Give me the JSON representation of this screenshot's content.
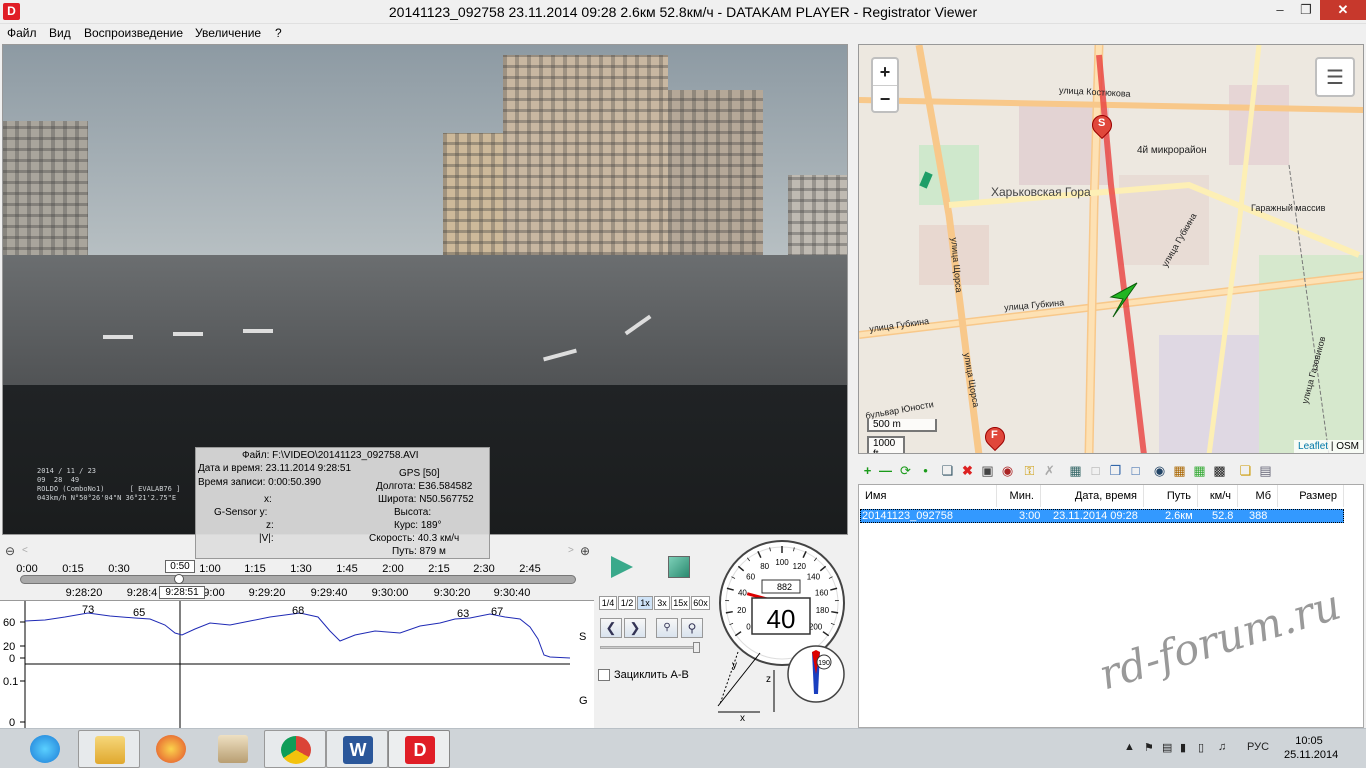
{
  "window": {
    "logo_letter": "D",
    "title": "20141123_092758     23.11.2014 09:28     2.6км     52.8км/ч   -  DATAKAM PLAYER - Registrator Viewer",
    "min": "–",
    "max": "❐",
    "close": "✕"
  },
  "menu": [
    "Файл",
    "Вид",
    "Воспроизведение",
    "Увеличение",
    "?"
  ],
  "video": {
    "osd": "2014 / 11 / 23\n09  28  49\nROLDO (ComboNo1)      [ EVALAB76 ]\n043km/h N°50°26'04\"N 36°21'2.75\"E"
  },
  "info": {
    "file": "Файл: F:\\VIDEO\\20141123_092758.AVI",
    "datetime": "Дата и время: 23.11.2014 9:28:51",
    "rec_time": "Время записи: 0:00:50.390",
    "gps": "GPS [50]",
    "lon": "Долгота: E36.584582",
    "lat": "Широта: N50.567752",
    "alt": "Высота:",
    "course": "Курс: 189°",
    "speed": "Скорость: 40.3 км/ч",
    "path": "Путь: 879 м",
    "x": "x:",
    "gsensor_y": "G-Sensor y:",
    "z": "z:",
    "v": "|V|:"
  },
  "timeline": {
    "ticks": [
      "0:00",
      "0:15",
      "0:30",
      "1:00",
      "1:15",
      "1:30",
      "1:45",
      "2:00",
      "2:15",
      "2:30",
      "2:45"
    ],
    "times": [
      "9:28:20",
      "9:28:4",
      "9:28:51",
      "9:00",
      "9:29:20",
      "9:29:40",
      "9:30:00",
      "9:30:20",
      "9:30:40"
    ],
    "position": "0:50",
    "position_time": "9:28:51",
    "progress": 0.27
  },
  "graph": {
    "speed_labels": [
      "73",
      "65",
      "68",
      "63",
      "67"
    ],
    "y_ticks_s": [
      "60",
      "20",
      "0"
    ],
    "y_ticks_g": [
      "0.1",
      "0"
    ],
    "axis_s": "S",
    "axis_g": "G"
  },
  "controls": {
    "speeds": [
      "1/4",
      "1/2",
      "1x",
      "3x",
      "15x",
      "60x"
    ],
    "loop_label": "Зациклить А-В"
  },
  "speedometer": {
    "value": "40",
    "odometer": "882",
    "scale": [
      "0",
      "20",
      "40",
      "60",
      "80",
      "100",
      "120",
      "140",
      "160",
      "180",
      "200"
    ],
    "speed_fraction": 0.2
  },
  "map": {
    "zoom_in": "+",
    "zoom_out": "−",
    "scale_m": "500 m",
    "scale_ft": "1000 ft",
    "attrib_leaflet": "Leaflet",
    "attrib_osm": "OSM",
    "streets": [
      "улица Костюкова",
      "4й микрорайон",
      "Харьковская Гора",
      "Гаражный массив",
      "улица Губкина",
      "улица Губкина",
      "улица Губкина",
      "улица Щорса",
      "улица Щорса",
      "бульвар Юности",
      "улица Газовиков"
    ],
    "start_marker": "S",
    "finish_marker": "F"
  },
  "table": {
    "headers": [
      "Имя",
      "Мин.",
      "Дата, время",
      "Путь",
      "км/ч",
      "Мб",
      "Размер"
    ],
    "rows": [
      [
        "20141123_092758",
        "3:00",
        "23.11.2014 09:28",
        "2.6км",
        "52.8",
        "388",
        ""
      ]
    ]
  },
  "taskbar": {
    "lang": "РУС",
    "time": "10:05",
    "date": "25.11.2014"
  },
  "watermark": "rd-forum.ru"
}
